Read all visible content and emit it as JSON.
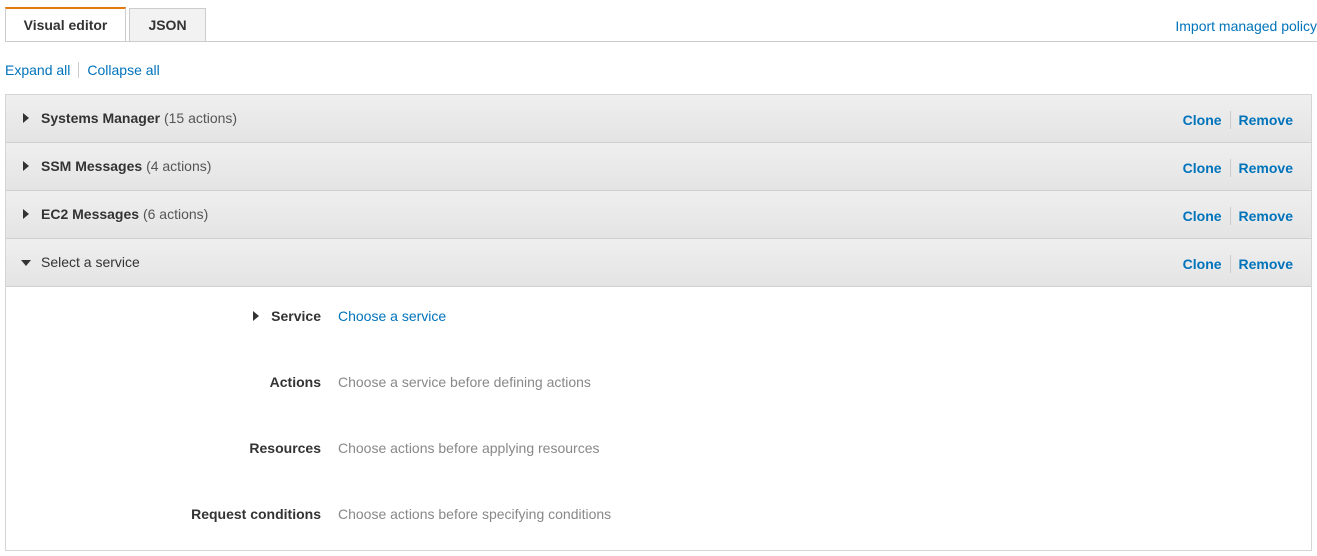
{
  "tabs": [
    {
      "label": "Visual editor",
      "active": true
    },
    {
      "label": "JSON",
      "active": false
    }
  ],
  "import_link": "Import managed policy",
  "expand_all": "Expand all",
  "collapse_all": "Collapse all",
  "statements": [
    {
      "service": "Systems Manager",
      "count": "(15 actions)",
      "expanded": false
    },
    {
      "service": "SSM Messages",
      "count": "(4 actions)",
      "expanded": false
    },
    {
      "service": "EC2 Messages",
      "count": "(6 actions)",
      "expanded": false
    },
    {
      "service": "Select a service",
      "count": "",
      "expanded": true
    }
  ],
  "row_actions": {
    "clone": "Clone",
    "remove": "Remove"
  },
  "fields": {
    "service": {
      "label": "Service",
      "value": "Choose a service"
    },
    "actions": {
      "label": "Actions",
      "value": "Choose a service before defining actions"
    },
    "resources": {
      "label": "Resources",
      "value": "Choose actions before applying resources"
    },
    "conditions": {
      "label": "Request conditions",
      "value": "Choose actions before specifying conditions"
    }
  },
  "colors": {
    "link": "#0073bb",
    "active_tab_accent": "#e47911",
    "muted": "#888888"
  },
  "icons": {
    "collapsed": "caret-right-icon",
    "expanded": "caret-down-icon"
  }
}
